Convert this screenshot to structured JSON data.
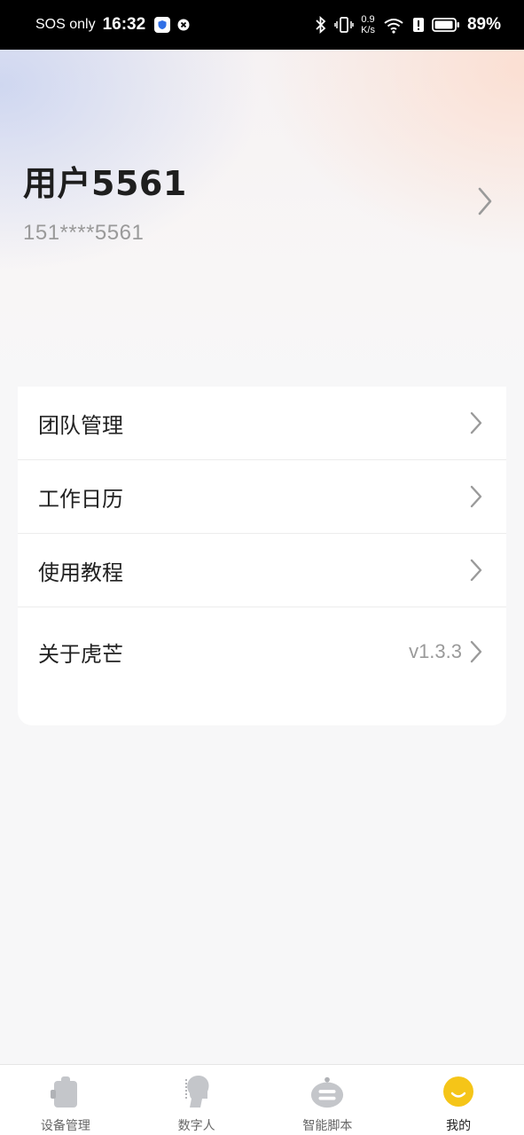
{
  "status_bar": {
    "carrier": "SOS only",
    "time": "16:32",
    "speed_value": "0.9",
    "speed_unit": "K/s",
    "battery": "89%"
  },
  "profile": {
    "name": "用户5561",
    "phone": "151****5561"
  },
  "menu": {
    "items": [
      {
        "label": "团队管理"
      },
      {
        "label": "工作日历"
      },
      {
        "label": "使用教程"
      },
      {
        "label": "关于虎芒",
        "value": "v1.3.3"
      }
    ]
  },
  "bottom_nav": {
    "items": [
      {
        "label": "设备管理",
        "icon": "device-icon"
      },
      {
        "label": "数字人",
        "icon": "digital-human-icon"
      },
      {
        "label": "智能脚本",
        "icon": "robot-script-icon"
      },
      {
        "label": "我的",
        "icon": "smile-icon",
        "active": true
      }
    ],
    "active_color": "#f5c518"
  }
}
